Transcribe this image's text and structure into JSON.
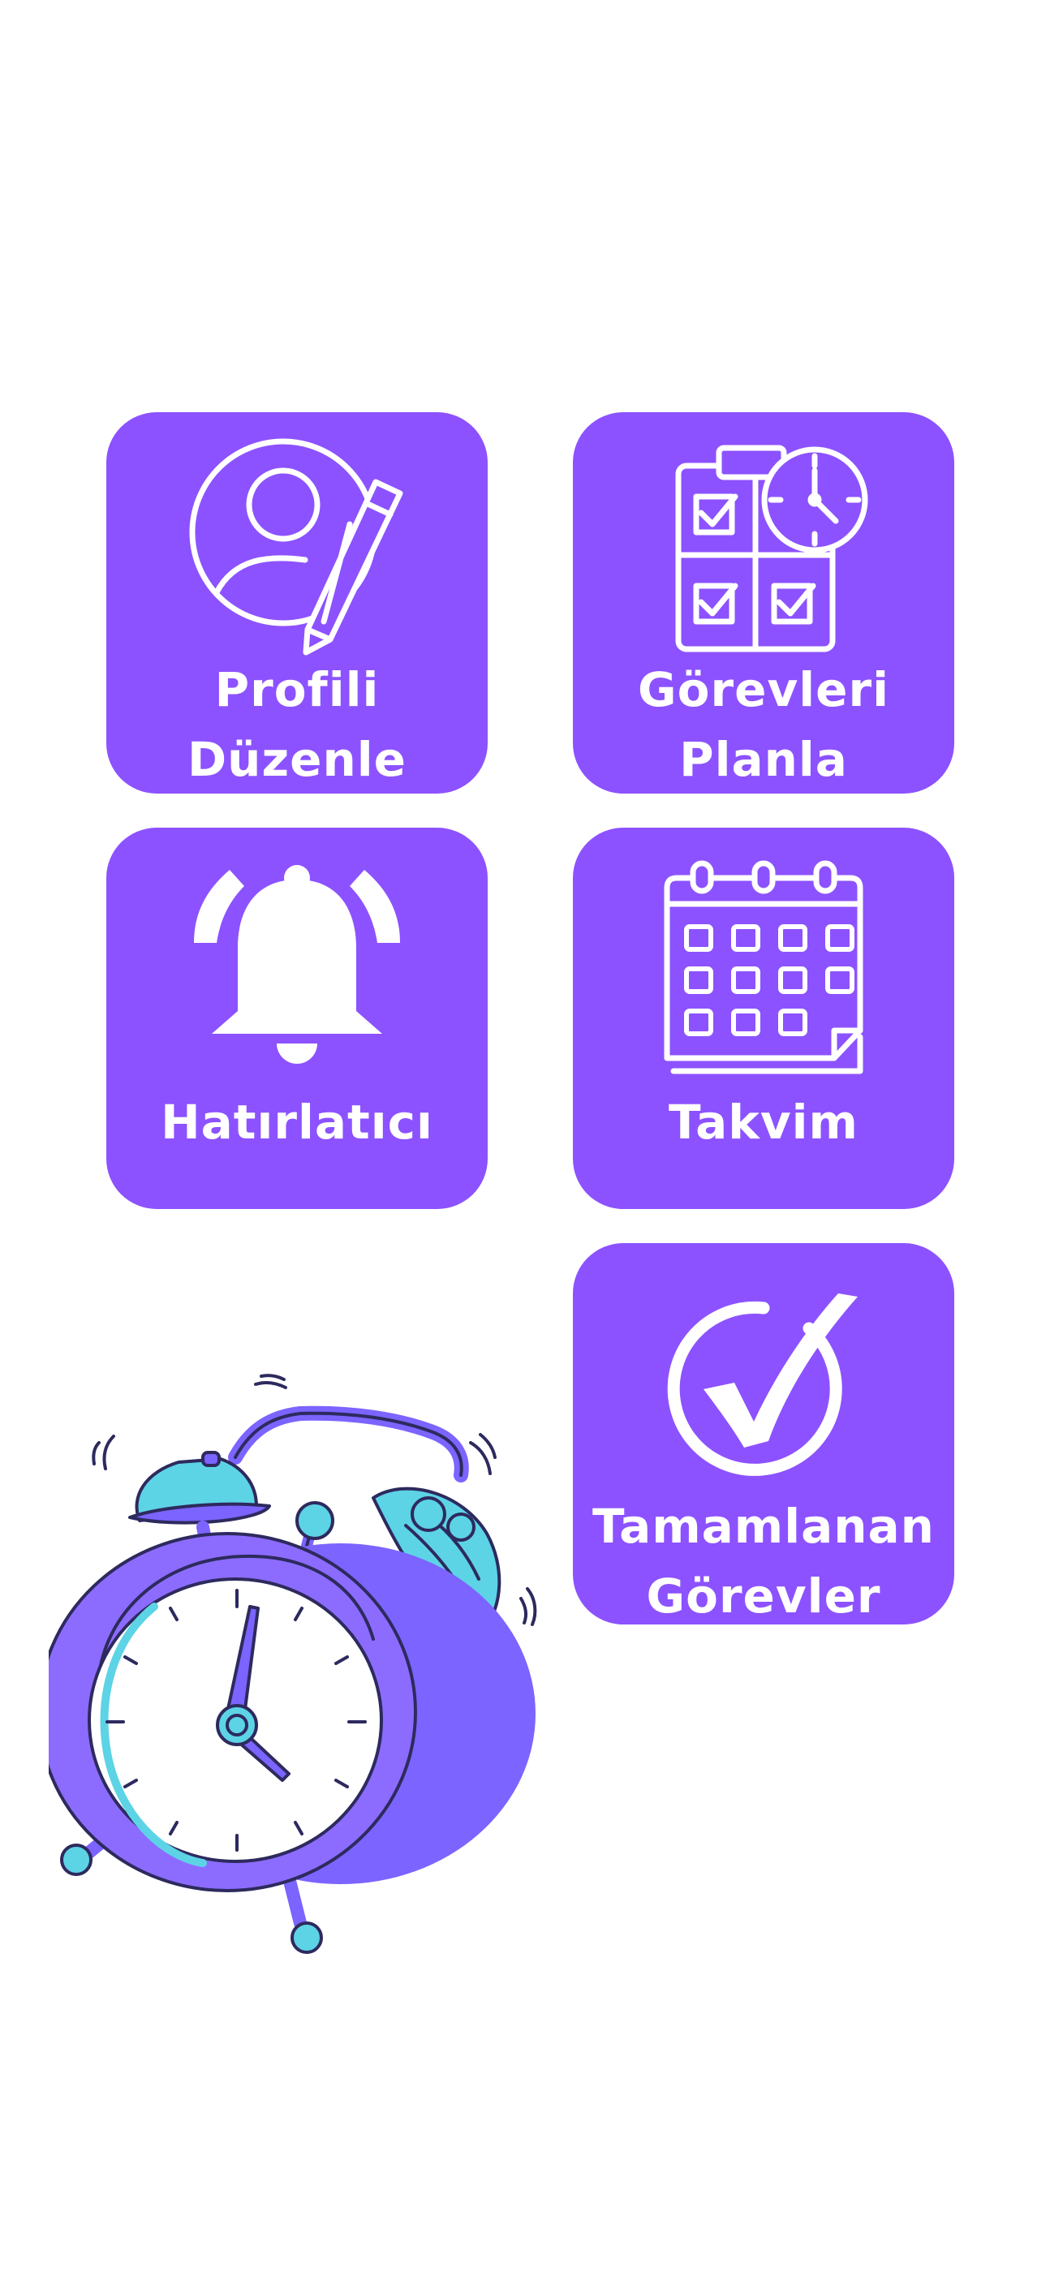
{
  "colors": {
    "tile_background": "#8c52ff",
    "tile_foreground": "#ffffff",
    "page_background": "#ffffff",
    "clock_body": "#7b64ff",
    "clock_accent": "#5dd3e6",
    "clock_outline": "#2d2a5e"
  },
  "tiles": [
    {
      "id": "edit-profile",
      "icon": "user-pencil-icon",
      "label_lines": [
        "Profili",
        "Düzenle"
      ]
    },
    {
      "id": "plan-tasks",
      "icon": "clipboard-clock-icon",
      "label_lines": [
        "Görevleri",
        "Planla"
      ]
    },
    {
      "id": "reminder",
      "icon": "bell-icon",
      "label_lines": [
        "Hatırlatıcı"
      ]
    },
    {
      "id": "calendar",
      "icon": "calendar-icon",
      "label_lines": [
        "Takvim"
      ]
    },
    {
      "id": "completed-tasks",
      "icon": "check-circle-icon",
      "label_lines": [
        "Tamamlanan",
        "Görevler"
      ]
    }
  ],
  "illustration": {
    "icon": "alarm-clock-illustration"
  }
}
